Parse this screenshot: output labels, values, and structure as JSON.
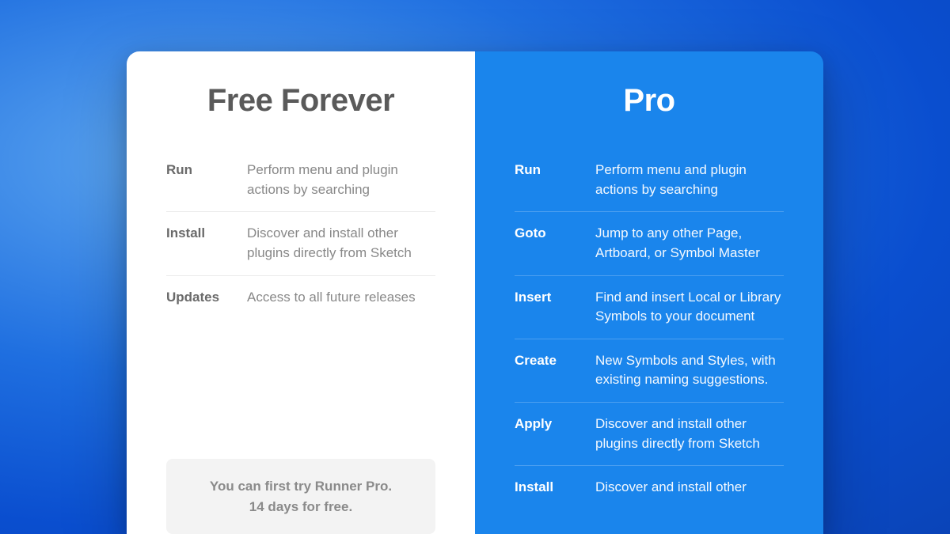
{
  "free": {
    "title": "Free Forever",
    "features": [
      {
        "name": "Run",
        "desc": "Perform menu and plugin actions by searching"
      },
      {
        "name": "Install",
        "desc": "Discover and install other plugins directly from Sketch"
      },
      {
        "name": "Updates",
        "desc": "Access to all future releases"
      }
    ],
    "trial_line1": "You can first try Runner Pro.",
    "trial_line2": "14 days for free."
  },
  "pro": {
    "title": "Pro",
    "features": [
      {
        "name": "Run",
        "desc": "Perform menu and plugin actions by searching"
      },
      {
        "name": "Goto",
        "desc": "Jump to any other Page, Artboard, or Symbol Master"
      },
      {
        "name": "Insert",
        "desc": "Find and insert Local or Library Symbols to your document"
      },
      {
        "name": "Create",
        "desc": "New Symbols and Styles, with existing naming suggestions."
      },
      {
        "name": "Apply",
        "desc": "Discover and install other plugins directly from Sketch"
      },
      {
        "name": "Install",
        "desc": "Discover and install other"
      }
    ]
  }
}
